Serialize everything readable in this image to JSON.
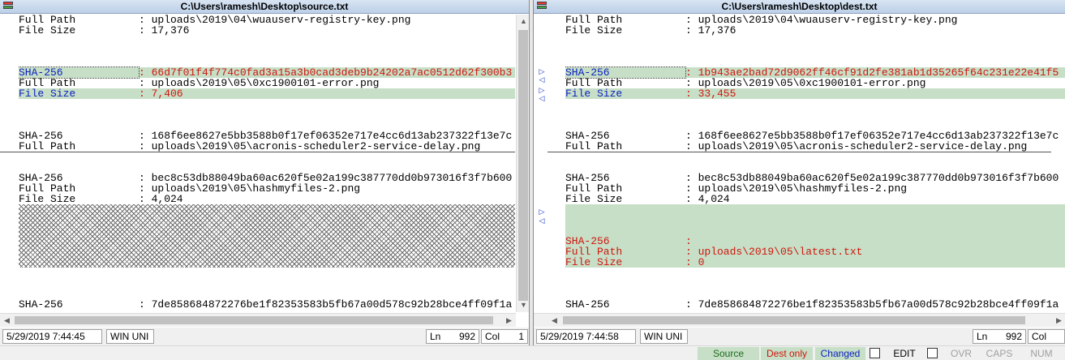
{
  "left": {
    "title": "C:\\Users\\ramesh\\Desktop\\source.txt",
    "lines": [
      [
        "Full Path",
        ": uploads\\2019\\04\\wuauserv-registry-key.png"
      ],
      [
        "File Size",
        ": 17,376"
      ],
      [
        "",
        ""
      ],
      [
        "",
        ""
      ],
      [
        "",
        ""
      ],
      [
        "SHA-256",
        ": 66d7f01f4f774c0fad3a15a3b0cad3deb9b24202a7ac0512d62f300b3"
      ],
      [
        "Full Path",
        ": uploads\\2019\\05\\0xc1900101-error.png"
      ],
      [
        "File Size",
        ": 7,406"
      ],
      [
        "",
        ""
      ],
      [
        "",
        ""
      ],
      [
        "",
        ""
      ],
      [
        "SHA-256",
        ": 168f6ee8627e5bb3588b0f17ef06352e717e4cc6d13ab237322f13e7c"
      ],
      [
        "Full Path",
        ": uploads\\2019\\05\\acronis-scheduler2-service-delay.png"
      ],
      [
        "",
        ""
      ],
      [
        "",
        ""
      ],
      [
        "SHA-256",
        ": bec8c53db88049ba60ac620f5e02a199c387770dd0b973016f3f7b600"
      ],
      [
        "Full Path",
        ": uploads\\2019\\05\\hashmyfiles-2.png"
      ],
      [
        "File Size",
        ": 4,024"
      ]
    ],
    "last_line": [
      "SHA-256",
      ": 7de858684872276be1f82353583b5fb67a00d578c92b28bce4ff09f1a"
    ],
    "date": "5/29/2019  7:44:45 PM",
    "encoding": "WIN UNI",
    "ln_label": "Ln",
    "ln_value": "992",
    "col_label": "Col",
    "col_value": "1"
  },
  "right": {
    "title": "C:\\Users\\ramesh\\Desktop\\dest.txt",
    "lines": [
      [
        "Full Path",
        ": uploads\\2019\\04\\wuauserv-registry-key.png"
      ],
      [
        "File Size",
        ": 17,376"
      ],
      [
        "",
        ""
      ],
      [
        "",
        ""
      ],
      [
        "",
        ""
      ],
      [
        "SHA-256",
        ": 1b943ae2bad72d9062ff46cf91d2fe381ab1d35265f64c231e22e41f5"
      ],
      [
        "Full Path",
        ": uploads\\2019\\05\\0xc1900101-error.png"
      ],
      [
        "File Size",
        ": 33,455"
      ],
      [
        "",
        ""
      ],
      [
        "",
        ""
      ],
      [
        "",
        ""
      ],
      [
        "SHA-256",
        ": 168f6ee8627e5bb3588b0f17ef06352e717e4cc6d13ab237322f13e7c"
      ],
      [
        "Full Path",
        ": uploads\\2019\\05\\acronis-scheduler2-service-delay.png"
      ],
      [
        "",
        ""
      ],
      [
        "",
        ""
      ],
      [
        "SHA-256",
        ": bec8c53db88049ba60ac620f5e02a199c387770dd0b973016f3f7b600"
      ],
      [
        "Full Path",
        ": uploads\\2019\\05\\hashmyfiles-2.png"
      ],
      [
        "File Size",
        ": 4,024"
      ]
    ],
    "inserted": [
      [
        "SHA-256",
        ":"
      ],
      [
        "Full Path",
        ": uploads\\2019\\05\\latest.txt"
      ],
      [
        "File Size",
        ": 0"
      ]
    ],
    "last_line": [
      "SHA-256",
      ": 7de858684872276be1f82353583b5fb67a00d578c92b28bce4ff09f1a"
    ],
    "date": "5/29/2019  7:44:58 PM",
    "encoding": "WIN UNI",
    "ln_label": "Ln",
    "ln_value": "992",
    "col_label": "Col",
    "col_value": "1"
  },
  "bottom": {
    "source_only": "Source Only",
    "dest_only": "Dest only",
    "changed": "Changed",
    "edit": "EDIT",
    "ovr": "OVR",
    "caps": "CAPS",
    "num": "NUM"
  },
  "colors": {
    "changed_bg": "#c6dfc6",
    "blue": "#0a1fc0",
    "red": "#d0160e"
  }
}
